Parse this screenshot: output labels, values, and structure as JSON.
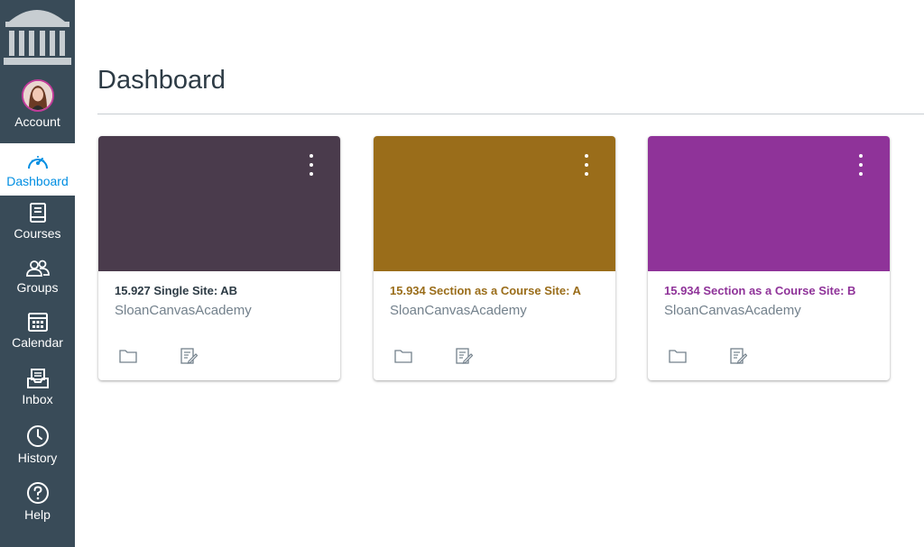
{
  "sidebar": {
    "items": [
      {
        "label": "Account",
        "icon": "avatar"
      },
      {
        "label": "Dashboard",
        "icon": "dashboard-icon",
        "active": true
      },
      {
        "label": "Courses",
        "icon": "courses-icon"
      },
      {
        "label": "Groups",
        "icon": "groups-icon"
      },
      {
        "label": "Calendar",
        "icon": "calendar-icon"
      },
      {
        "label": "Inbox",
        "icon": "inbox-icon"
      },
      {
        "label": "History",
        "icon": "history-icon"
      },
      {
        "label": "Help",
        "icon": "help-icon"
      }
    ],
    "background": "#394B58",
    "active_color": "#008EE2"
  },
  "main": {
    "title": "Dashboard"
  },
  "cards": [
    {
      "title": "15.927 Single Site: AB",
      "subtitle": "SloanCanvasAcademy",
      "color": "#4A3B4C",
      "title_color": "#2D3B45"
    },
    {
      "title": "15.934 Section as a Course Site: A",
      "subtitle": "SloanCanvasAcademy",
      "color": "#9A6D1A",
      "title_color": "#9A6D1A"
    },
    {
      "title": "15.934 Section as a Course Site: B",
      "subtitle": "SloanCanvasAcademy",
      "color": "#8F3399",
      "title_color": "#8F3399"
    }
  ]
}
